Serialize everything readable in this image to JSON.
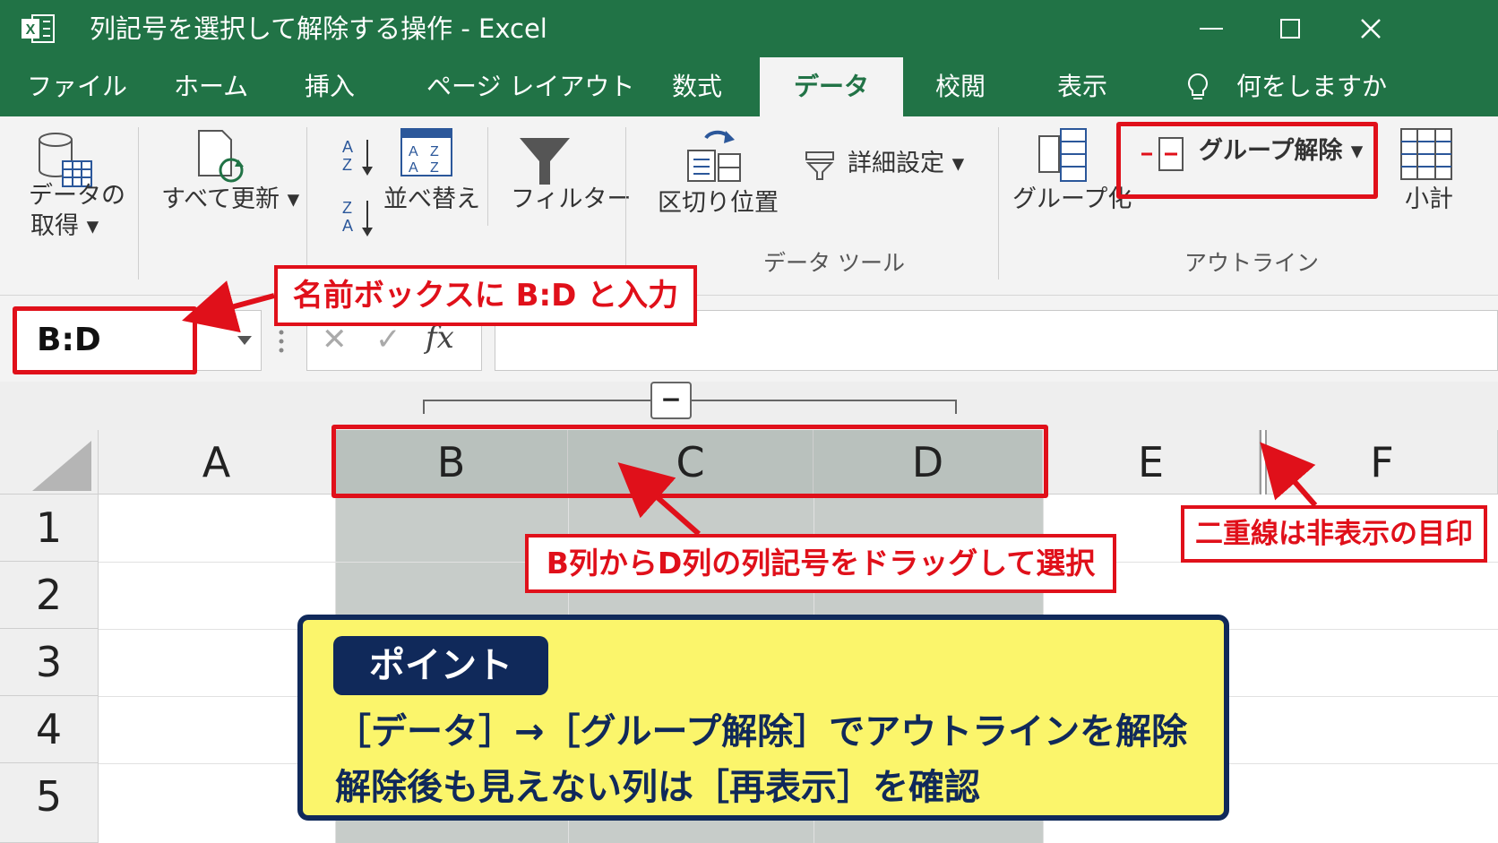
{
  "window": {
    "title": "列記号を選択して解除する操作 - Excel",
    "minimize": "—",
    "maximize": "☐",
    "close": "✕"
  },
  "tabs": [
    {
      "label": "ファイル"
    },
    {
      "label": "ホーム"
    },
    {
      "label": "挿入"
    },
    {
      "label": "ページ レイアウト"
    },
    {
      "label": "数式"
    },
    {
      "label": "データ",
      "active": true
    },
    {
      "label": "校閲"
    },
    {
      "label": "表示"
    }
  ],
  "tell_me": "何をしますか",
  "ribbon": {
    "get_data_1": "データの",
    "get_data_2": "取得 ▾",
    "refresh_all": "すべて更新 ▾",
    "sort": "並べ替え",
    "filter": "フィルター",
    "text_to_columns": "区切り位置",
    "advanced": "詳細設定 ▾",
    "data_tools_group": "データ ツール",
    "group": "グループ化",
    "ungroup": "グループ解除 ▾",
    "subtotal": "小計",
    "outline_group": "アウトライン"
  },
  "name_box": {
    "value": "B:D"
  },
  "formula_bar": {
    "cancel": "✕",
    "enter": "✓",
    "fx": "fx",
    "value": ""
  },
  "outline": {
    "collapse": "−"
  },
  "columns": [
    "A",
    "B",
    "C",
    "D",
    "E",
    "F"
  ],
  "rows": [
    "1",
    "2",
    "3",
    "4",
    "5"
  ],
  "annotations": {
    "name_box_callout": "名前ボックスに B:D と入力",
    "drag_callout": "B列からD列の列記号をドラッグして選択",
    "hidden_callout": "二重線は非表示の目印",
    "point_title": "ポイント",
    "point_line1": "［データ］→［グループ解除］でアウトラインを解除",
    "point_line2": "解除後も見えない列は［再表示］を確認"
  },
  "colors": {
    "excel_green": "#217346",
    "annotation_red": "#e0101a",
    "point_navy": "#10295a",
    "point_yellow": "#fbf56b"
  }
}
